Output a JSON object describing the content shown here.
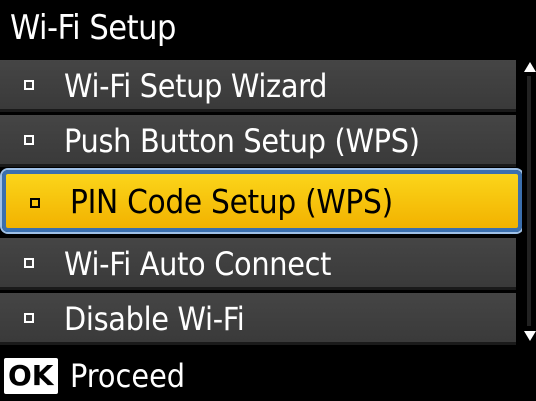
{
  "header": {
    "title": "Wi-Fi Setup"
  },
  "menu": {
    "items": [
      {
        "label": "Wi-Fi Setup Wizard",
        "selected": false
      },
      {
        "label": "Push Button Setup (WPS)",
        "selected": false
      },
      {
        "label": "PIN Code Setup (WPS)",
        "selected": true
      },
      {
        "label": "Wi-Fi Auto Connect",
        "selected": false
      },
      {
        "label": "Disable Wi-Fi",
        "selected": false
      }
    ]
  },
  "scrollbar": {
    "up_icon": "arrow-up-icon",
    "down_icon": "arrow-down-icon"
  },
  "footer": {
    "button_label": "OK",
    "action_label": "Proceed"
  },
  "colors": {
    "background": "#000000",
    "item_background": "#3f3f3f",
    "selected_background": "#f7c40a",
    "selected_border": "#3b6fae"
  }
}
